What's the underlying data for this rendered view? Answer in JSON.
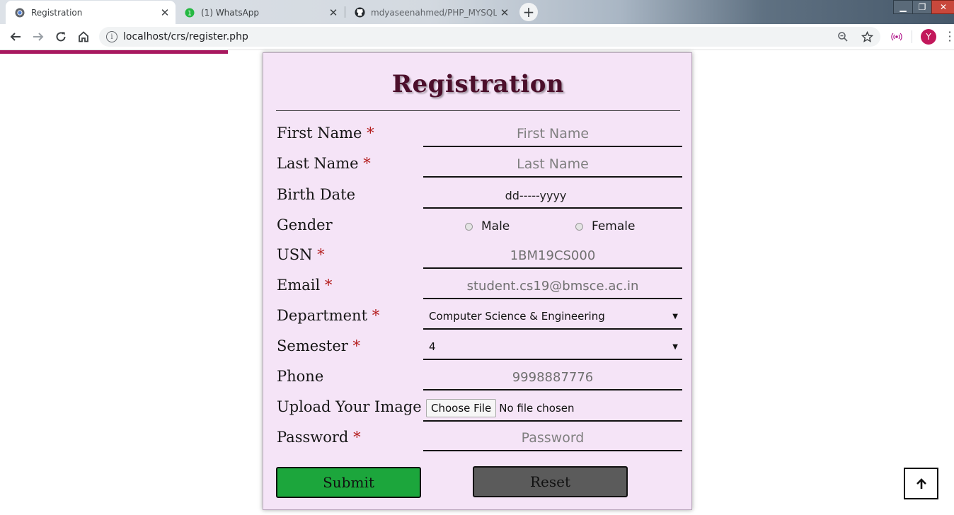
{
  "browser": {
    "tabs": [
      {
        "title": "Registration",
        "active": true,
        "icon": "chromium-icon"
      },
      {
        "title": "(1) WhatsApp",
        "active": false,
        "icon": "whatsapp-icon"
      },
      {
        "title": "mdyaseenahmed/PHP_MYSQL_E",
        "active": false,
        "icon": "github-icon"
      }
    ],
    "url": "localhost/crs/register.php",
    "profile_initial": "Y",
    "accent_color": "#a8185f"
  },
  "form": {
    "title": "Registration",
    "required_mark": "*",
    "background_color": "#f5e4f7",
    "fields": {
      "first_name": {
        "label": "First Name",
        "placeholder": "First Name"
      },
      "last_name": {
        "label": "Last Name",
        "placeholder": "Last Name"
      },
      "birth_date": {
        "label": "Birth Date",
        "placeholder": "dd-----yyyy"
      },
      "gender": {
        "label": "Gender",
        "options": [
          "Male",
          "Female"
        ]
      },
      "usn": {
        "label": "USN",
        "placeholder": "1BM19CS000"
      },
      "email": {
        "label": "Email",
        "placeholder": "student.cs19@bmsce.ac.in"
      },
      "department": {
        "label": "Department",
        "selected": "Computer Science & Engineering"
      },
      "semester": {
        "label": "Semester",
        "selected": "4"
      },
      "phone": {
        "label": "Phone",
        "placeholder": "9998887776"
      },
      "image": {
        "label": "Upload Your Image",
        "button": "Choose File",
        "status": "No file chosen"
      },
      "password": {
        "label": "Password",
        "placeholder": "Password"
      }
    },
    "buttons": {
      "submit": {
        "label": "Submit",
        "color": "#1ca63c"
      },
      "reset": {
        "label": "Reset",
        "color": "#5b5b5b"
      }
    }
  }
}
